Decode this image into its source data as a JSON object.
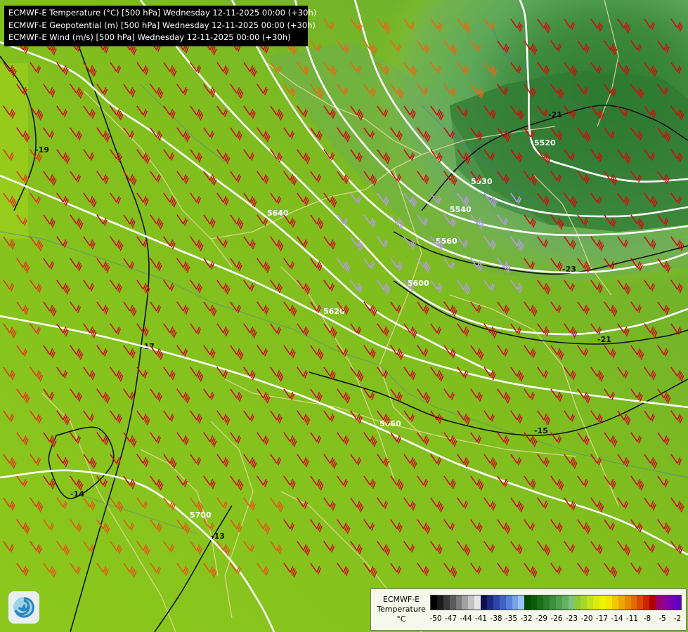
{
  "header": {
    "line1": "ECMWF-E Temperature (°C) [500 hPa] Wednesday 12-11-2025 00:00 (+30h)",
    "line2": "ECMWF-E Geopotential (m) [500 hPa] Wednesday 12-11-2025 00:00 (+30h)",
    "line3": "ECMWF-E Wind (m/s) [500 hPa] Wednesday 12-11-2025 00:00 (+30h)"
  },
  "legend": {
    "title_line1": "ECMWF-E",
    "title_line2": "Temperature",
    "unit": "°C",
    "colors": [
      "#000000",
      "#1a1a1a",
      "#3a3a3a",
      "#5a5a5a",
      "#7d7d7d",
      "#a0a0a0",
      "#c4c4c4",
      "#e6e6e6",
      "#10104e",
      "#1c2a80",
      "#2d46a8",
      "#3d64c4",
      "#5582d8",
      "#77a3e8",
      "#99c4f6",
      "#004b00",
      "#0b5c0b",
      "#1a6d1a",
      "#2a7e2a",
      "#3b8f3b",
      "#4ea04e",
      "#64b164",
      "#7dc27d",
      "#8ccc3a",
      "#a6d82a",
      "#c0e31c",
      "#d9ee10",
      "#eef500",
      "#f5e600",
      "#f0c800",
      "#eca800",
      "#e88a00",
      "#e46c00",
      "#d84800",
      "#c82600",
      "#b00000",
      "#a0006e",
      "#8c00a0",
      "#7800b4",
      "#6400c8"
    ],
    "ticks": [
      "-50",
      "-47",
      "-44",
      "-41",
      "-38",
      "-35",
      "-32",
      "-29",
      "-26",
      "-23",
      "-20",
      "-17",
      "-14",
      "-11",
      "-8",
      "-5",
      "-2"
    ]
  },
  "isohypses": [
    {
      "value": "5520",
      "points": [
        [
          740,
          0
        ],
        [
          748,
          30
        ],
        [
          752,
          120
        ],
        [
          760,
          210
        ],
        [
          820,
          240
        ],
        [
          900,
          258
        ],
        [
          979,
          255
        ]
      ]
    },
    {
      "value": "5530",
      "points": [
        [
          505,
          0
        ],
        [
          540,
          110
        ],
        [
          600,
          200
        ],
        [
          670,
          265
        ],
        [
          760,
          300
        ],
        [
          880,
          308
        ],
        [
          979,
          295
        ]
      ]
    },
    {
      "value": "5540",
      "points": [
        [
          420,
          0
        ],
        [
          445,
          90
        ],
        [
          490,
          170
        ],
        [
          560,
          250
        ],
        [
          640,
          305
        ],
        [
          760,
          332
        ],
        [
          880,
          333
        ],
        [
          979,
          322
        ]
      ]
    },
    {
      "value": "5560",
      "points": [
        [
          330,
          0
        ],
        [
          390,
          110
        ],
        [
          450,
          200
        ],
        [
          530,
          290
        ],
        [
          620,
          350
        ],
        [
          720,
          380
        ],
        [
          830,
          388
        ],
        [
          930,
          375
        ],
        [
          979,
          360
        ]
      ]
    },
    {
      "value": "5600",
      "points": [
        [
          200,
          0
        ],
        [
          270,
          90
        ],
        [
          340,
          170
        ],
        [
          420,
          250
        ],
        [
          500,
          330
        ],
        [
          580,
          410
        ],
        [
          680,
          460
        ],
        [
          800,
          476
        ],
        [
          900,
          465
        ],
        [
          979,
          440
        ]
      ]
    },
    {
      "value": "5620",
      "points": [
        [
          0,
          250
        ],
        [
          120,
          300
        ],
        [
          240,
          350
        ],
        [
          360,
          400
        ],
        [
          460,
          450
        ],
        [
          560,
          500
        ],
        [
          700,
          540
        ],
        [
          820,
          560
        ],
        [
          979,
          580
        ]
      ]
    },
    {
      "value": "5640",
      "points": [
        [
          0,
          60
        ],
        [
          100,
          100
        ],
        [
          160,
          150
        ],
        [
          220,
          190
        ],
        [
          300,
          250
        ],
        [
          380,
          310
        ],
        [
          450,
          370
        ],
        [
          530,
          440
        ],
        [
          620,
          490
        ],
        [
          700,
          530
        ]
      ]
    },
    {
      "value": "5660",
      "points": [
        [
          0,
          450
        ],
        [
          150,
          480
        ],
        [
          300,
          520
        ],
        [
          420,
          560
        ],
        [
          540,
          610
        ],
        [
          650,
          660
        ],
        [
          760,
          700
        ],
        [
          880,
          740
        ],
        [
          979,
          790
        ]
      ]
    },
    {
      "value": "5700",
      "points": [
        [
          0,
          680
        ],
        [
          100,
          670
        ],
        [
          200,
          690
        ],
        [
          270,
          740
        ],
        [
          330,
          800
        ],
        [
          370,
          860
        ],
        [
          390,
          900
        ]
      ]
    }
  ],
  "isotherms": [
    {
      "value": "-21",
      "points": [
        [
          600,
          300
        ],
        [
          650,
          240
        ],
        [
          700,
          200
        ],
        [
          780,
          170
        ],
        [
          860,
          150
        ],
        [
          930,
          170
        ],
        [
          979,
          200
        ]
      ]
    },
    {
      "value": "-23",
      "points": [
        [
          560,
          330
        ],
        [
          620,
          360
        ],
        [
          700,
          380
        ],
        [
          800,
          390
        ],
        [
          900,
          370
        ],
        [
          979,
          350
        ]
      ]
    },
    {
      "value": "-21",
      "points": [
        [
          560,
          400
        ],
        [
          640,
          450
        ],
        [
          740,
          480
        ],
        [
          850,
          490
        ],
        [
          940,
          480
        ],
        [
          979,
          470
        ]
      ]
    },
    {
      "value": "-19",
      "points": [
        [
          0,
          80
        ],
        [
          40,
          140
        ],
        [
          50,
          220
        ],
        [
          20,
          300
        ]
      ]
    },
    {
      "value": "-17",
      "points": [
        [
          110,
          60
        ],
        [
          160,
          200
        ],
        [
          210,
          350
        ],
        [
          200,
          500
        ],
        [
          180,
          620
        ],
        [
          140,
          760
        ],
        [
          100,
          900
        ]
      ]
    },
    {
      "value": "-15",
      "points": [
        [
          440,
          530
        ],
        [
          540,
          560
        ],
        [
          640,
          600
        ],
        [
          760,
          620
        ],
        [
          860,
          600
        ],
        [
          979,
          540
        ]
      ]
    },
    {
      "value": "-14",
      "points": [
        [
          80,
          620
        ],
        [
          140,
          610
        ],
        [
          160,
          660
        ],
        [
          100,
          710
        ],
        [
          70,
          660
        ],
        [
          80,
          620
        ]
      ]
    },
    {
      "value": "-13",
      "points": [
        [
          220,
          900
        ],
        [
          260,
          840
        ],
        [
          300,
          770
        ],
        [
          330,
          720
        ]
      ]
    }
  ]
}
